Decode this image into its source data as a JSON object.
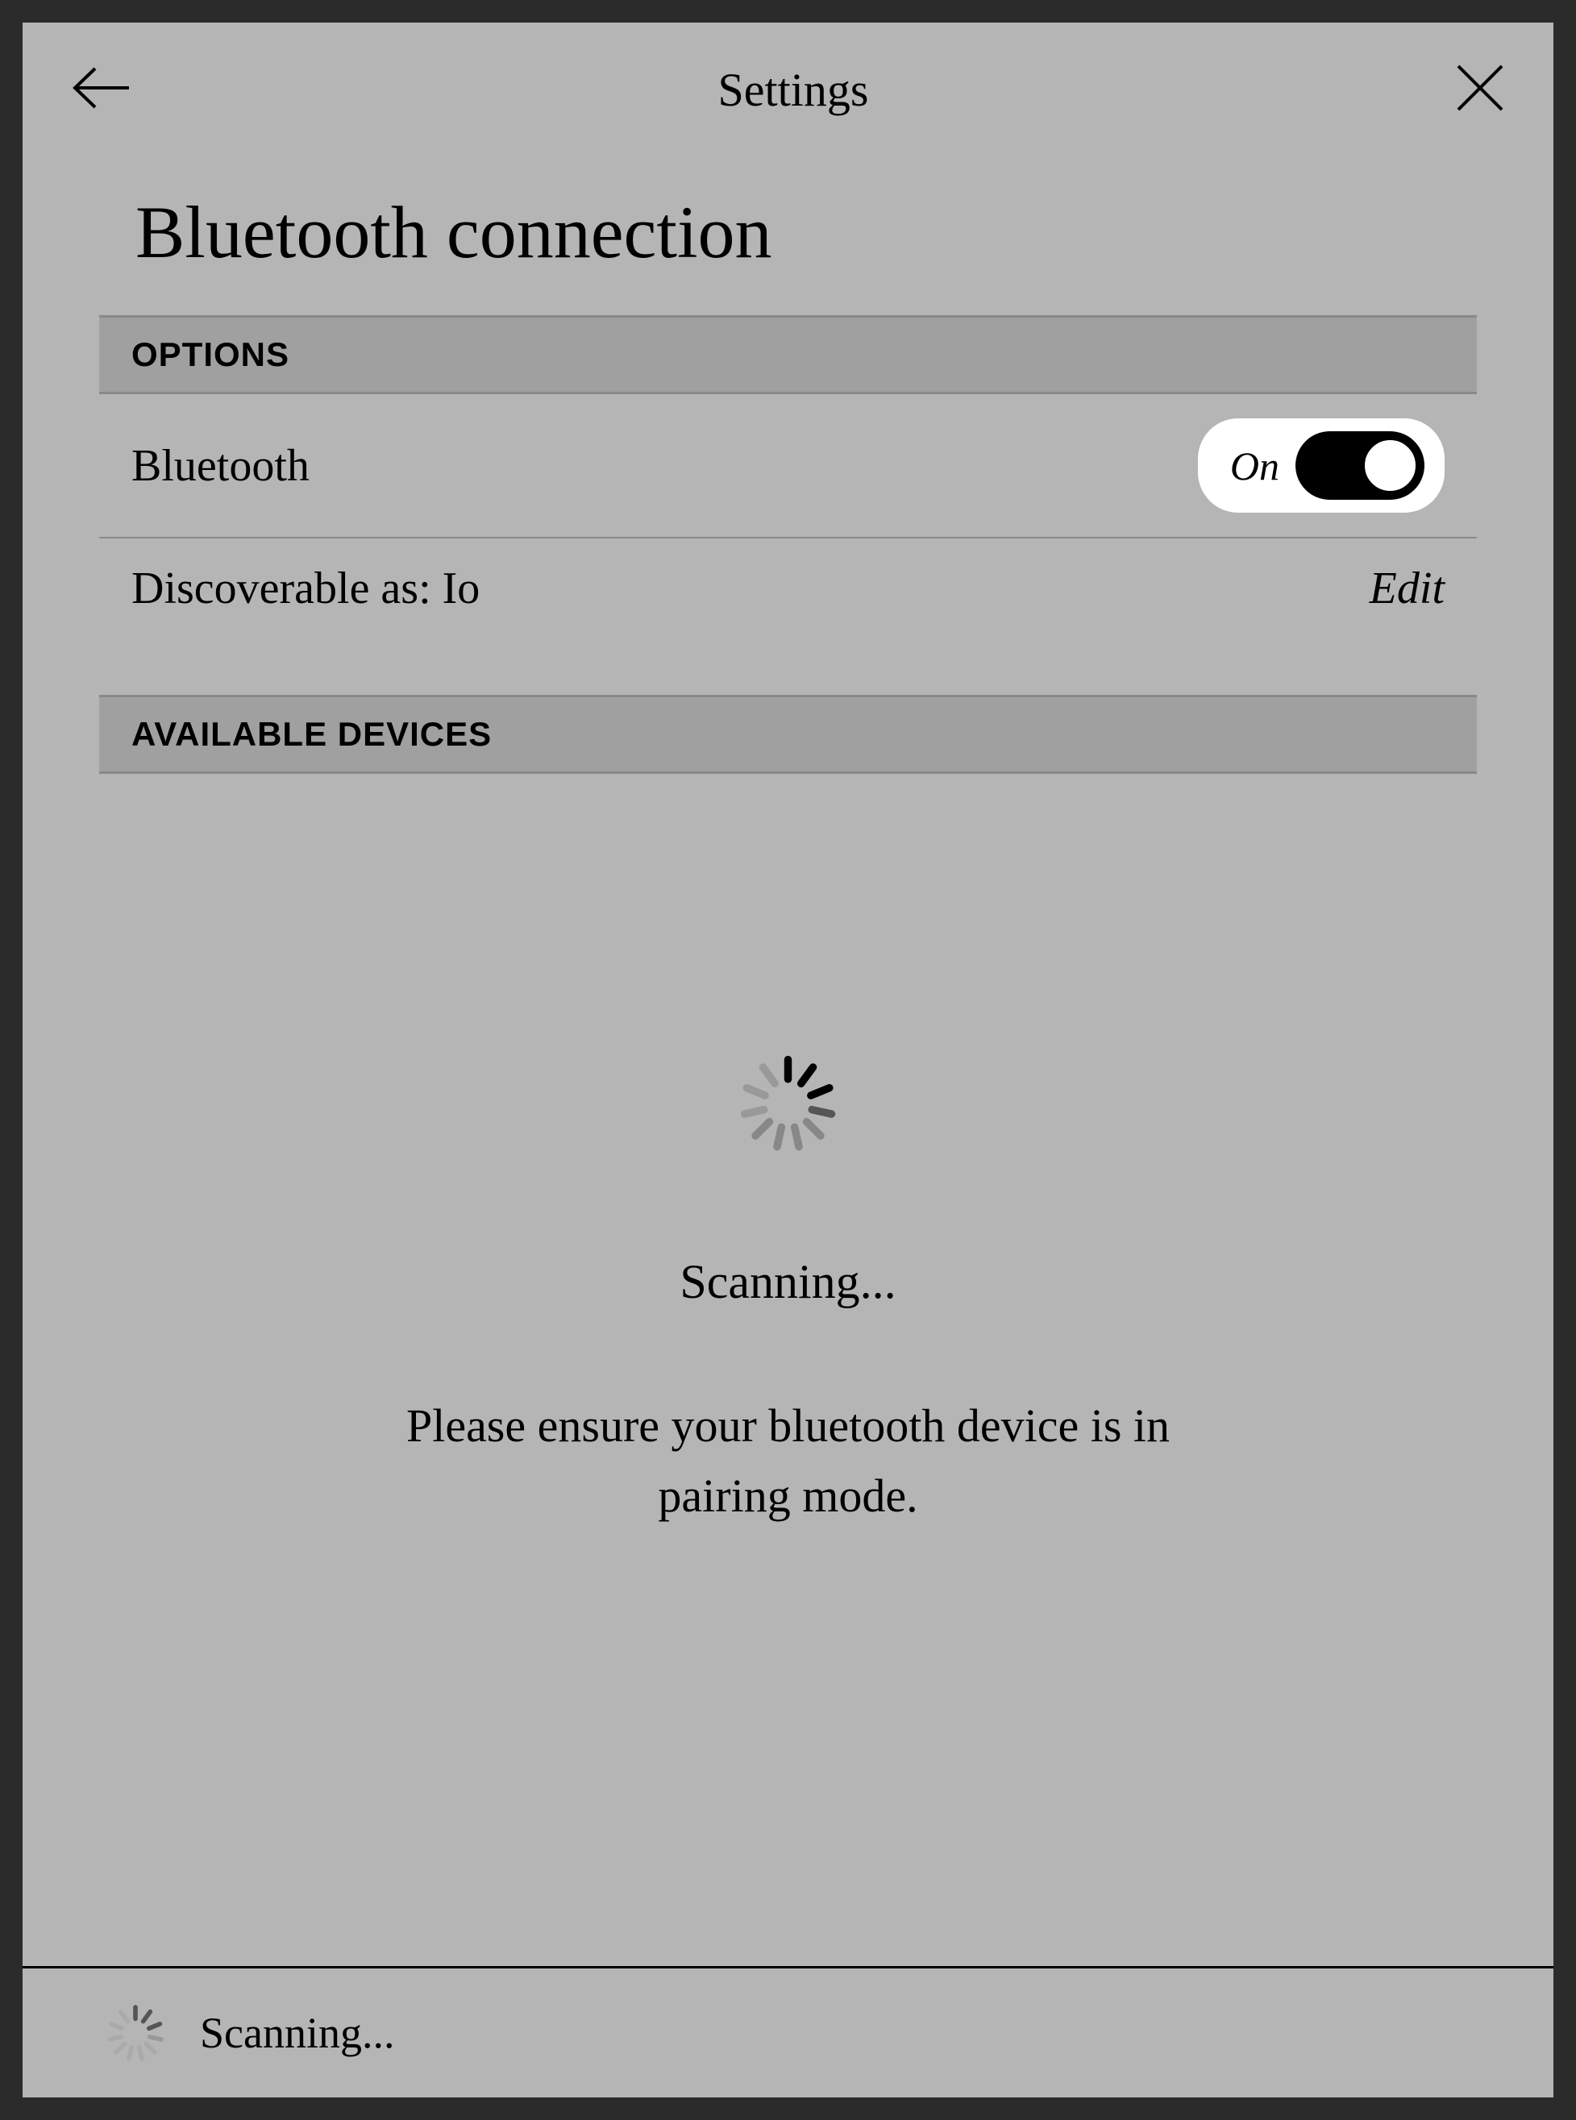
{
  "header": {
    "title": "Settings"
  },
  "page": {
    "title": "Bluetooth connection"
  },
  "sections": {
    "options": {
      "header": "OPTIONS",
      "bluetooth": {
        "label": "Bluetooth",
        "toggle_state": "On"
      },
      "discoverable": {
        "label": "Discoverable as: Io",
        "action": "Edit"
      }
    },
    "devices": {
      "header": "AVAILABLE DEVICES"
    }
  },
  "scanning": {
    "status": "Scanning...",
    "instruction": "Please ensure your bluetooth device is in pairing mode."
  },
  "footer": {
    "status": "Scanning..."
  }
}
